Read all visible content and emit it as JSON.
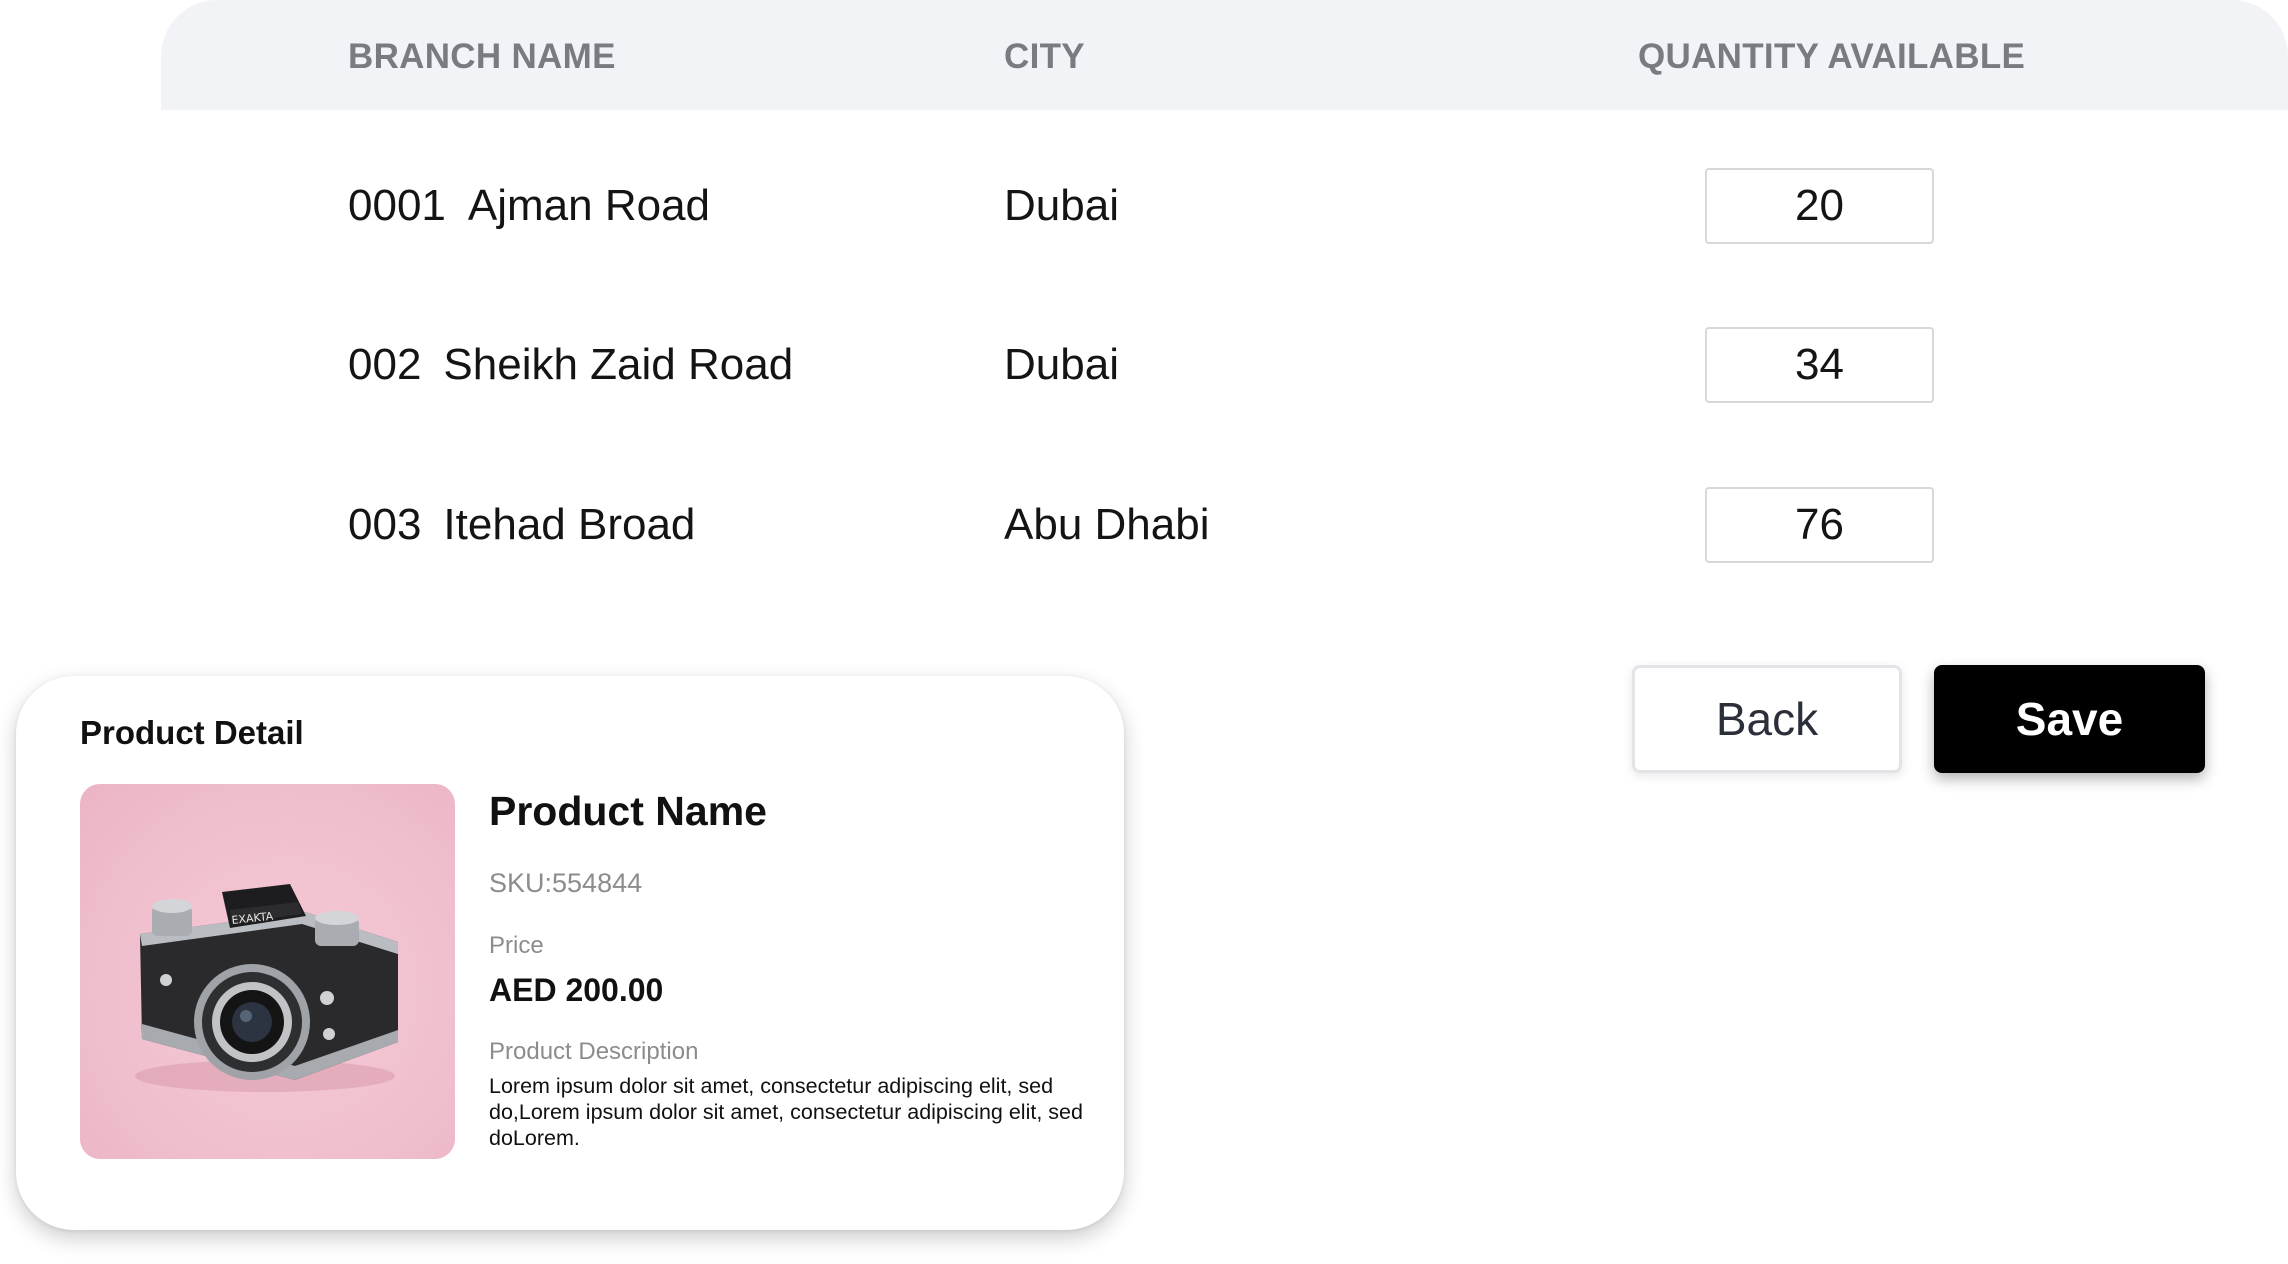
{
  "table": {
    "headers": {
      "branch_name": "BRANCH NAME",
      "city": "CITY",
      "quantity": "QUANTITY AVAILABLE"
    },
    "rows": [
      {
        "code": "0001",
        "branch": "Ajman Road",
        "city": "Dubai",
        "quantity": "20"
      },
      {
        "code": "002",
        "branch": "Sheikh Zaid Road",
        "city": "Dubai",
        "quantity": "34"
      },
      {
        "code": "003",
        "branch": "Itehad Broad",
        "city": "Abu Dhabi",
        "quantity": "76"
      }
    ]
  },
  "actions": {
    "back_label": "Back",
    "save_label": "Save"
  },
  "product_detail": {
    "title": "Product Detail",
    "name": "Product Name",
    "sku": "SKU:554844",
    "price_label": "Price",
    "price": "AED 200.00",
    "description_label": "Product Description",
    "description": "Lorem ipsum dolor sit amet, consectetur adipiscing elit, sed do,Lorem ipsum dolor sit amet, consectetur adipiscing elit, sed doLorem.",
    "image": {
      "icon": "camera-icon",
      "camera_brand_text": "EXAKTA"
    }
  },
  "colors": {
    "header_bg": "#f2f3f6",
    "header_text": "#7a7b81",
    "save_bg": "#000000",
    "image_bg": "#f0bfcd"
  }
}
